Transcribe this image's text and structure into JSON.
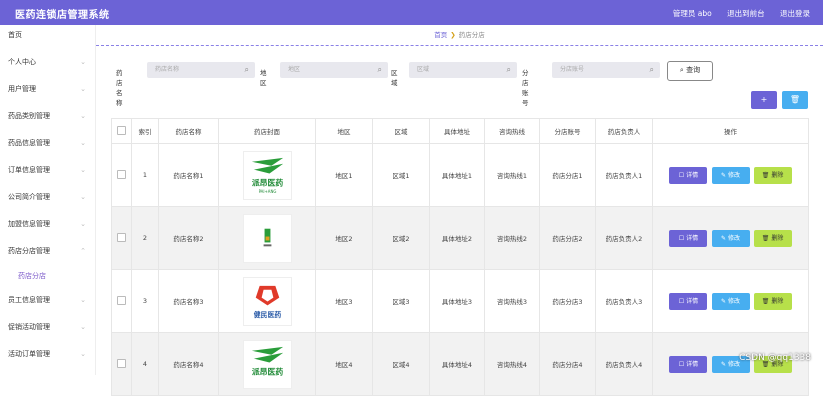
{
  "header": {
    "app_title": "医药连锁店管理系统",
    "admin_label": "管理员 abo",
    "back_label": "退出到前台",
    "logout_label": "退出登录"
  },
  "sidebar": {
    "items": [
      {
        "label": "首页"
      },
      {
        "label": "个人中心"
      },
      {
        "label": "用户管理"
      },
      {
        "label": "药品类别管理"
      },
      {
        "label": "药品信息管理"
      },
      {
        "label": "订单信息管理"
      },
      {
        "label": "公司简介管理"
      },
      {
        "label": "加盟信息管理"
      },
      {
        "label": "药店分店管理"
      },
      {
        "label": "员工信息管理"
      },
      {
        "label": "促销活动管理"
      },
      {
        "label": "活动订单管理"
      }
    ],
    "active_sub": "药店分店"
  },
  "breadcrumb": {
    "home": "首页",
    "current": "药店分店"
  },
  "search": {
    "name_label": "药店名称",
    "name_placeholder": "药店名称",
    "region_label": "地区",
    "region_placeholder": "地区",
    "area_label": "区域",
    "area_placeholder": "区域",
    "account_label": "分店账号",
    "account_placeholder": "分店账号",
    "query_label": "查询"
  },
  "toolbar": {
    "add_label": "+",
    "delete_label": "🗑"
  },
  "table": {
    "headers": [
      "索引",
      "药店名称",
      "药店封面",
      "地区",
      "区域",
      "具体地址",
      "咨询热线",
      "分店账号",
      "药店负责人",
      "操作"
    ],
    "rows": [
      {
        "index": "1",
        "name": "药店名称1",
        "region": "地区1",
        "area": "区域1",
        "address": "具体地址1",
        "hotline": "咨询热线1",
        "account": "药店分店1",
        "manager": "药店负责人1"
      },
      {
        "index": "2",
        "name": "药店名称2",
        "region": "地区2",
        "area": "区域2",
        "address": "具体地址2",
        "hotline": "咨询热线2",
        "account": "药店分店2",
        "manager": "药店负责人2"
      },
      {
        "index": "3",
        "name": "药店名称3",
        "region": "地区3",
        "area": "区域3",
        "address": "具体地址3",
        "hotline": "咨询热线3",
        "account": "药店分店3",
        "manager": "药店负责人3"
      },
      {
        "index": "4",
        "name": "药店名称4",
        "region": "地区4",
        "area": "区域4",
        "address": "具体地址4",
        "hotline": "咨询热线4",
        "account": "药店分店4",
        "manager": "药店负责人4"
      }
    ],
    "actions": {
      "detail": "详情",
      "edit": "修改",
      "delete": "删除"
    }
  },
  "logos": [
    "派昂医药",
    "",
    "健民医药",
    "派昂医药"
  ],
  "watermark": "CSDN @qq1338"
}
